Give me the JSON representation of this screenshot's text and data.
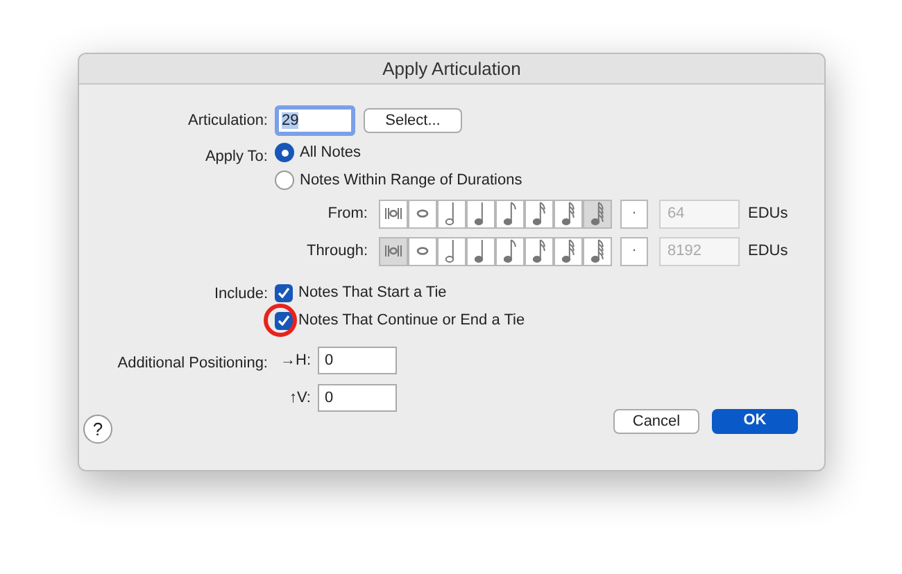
{
  "window": {
    "title": "Apply Articulation"
  },
  "articulation": {
    "label": "Articulation:",
    "value": "29",
    "button": "Select..."
  },
  "apply_to": {
    "label": "Apply To:",
    "options": [
      {
        "label": "All Notes",
        "selected": true
      },
      {
        "label": "Notes Within Range of Durations",
        "selected": false
      }
    ]
  },
  "ranges": [
    {
      "label": "From:",
      "durations": [
        {
          "kind": "breve",
          "selected": false
        },
        {
          "kind": "whole",
          "selected": false
        },
        {
          "kind": "half",
          "selected": false
        },
        {
          "kind": "quarter",
          "selected": false
        },
        {
          "kind": "eighth",
          "selected": false
        },
        {
          "kind": "sixteenth",
          "selected": false
        },
        {
          "kind": "thirtysecond",
          "selected": false
        },
        {
          "kind": "sixtyfourth",
          "selected": true
        }
      ],
      "dot_selected": false,
      "dot": ".",
      "value": "64",
      "disabled": true,
      "unit": "EDUs"
    },
    {
      "label": "Through:",
      "durations": [
        {
          "kind": "breve",
          "selected": true
        },
        {
          "kind": "whole",
          "selected": false
        },
        {
          "kind": "half",
          "selected": false
        },
        {
          "kind": "quarter",
          "selected": false
        },
        {
          "kind": "eighth",
          "selected": false
        },
        {
          "kind": "sixteenth",
          "selected": false
        },
        {
          "kind": "thirtysecond",
          "selected": false
        },
        {
          "kind": "sixtyfourth",
          "selected": false
        }
      ],
      "dot_selected": false,
      "dot": ".",
      "value": "8192",
      "disabled": true,
      "unit": "EDUs"
    }
  ],
  "include": {
    "label": "Include:",
    "options": [
      {
        "label": "Notes That Start a Tie",
        "checked": true
      },
      {
        "label": "Notes That Continue or End a Tie",
        "checked": true,
        "annotated": true
      }
    ]
  },
  "positioning": {
    "label": "Additional Positioning:",
    "fields": [
      {
        "label": "→H:",
        "value": "0"
      },
      {
        "label": "↑V:",
        "value": "0"
      }
    ]
  },
  "help": "?",
  "buttons": [
    {
      "label": "Cancel",
      "kind": "secondary"
    },
    {
      "label": "OK",
      "kind": "primary"
    }
  ]
}
